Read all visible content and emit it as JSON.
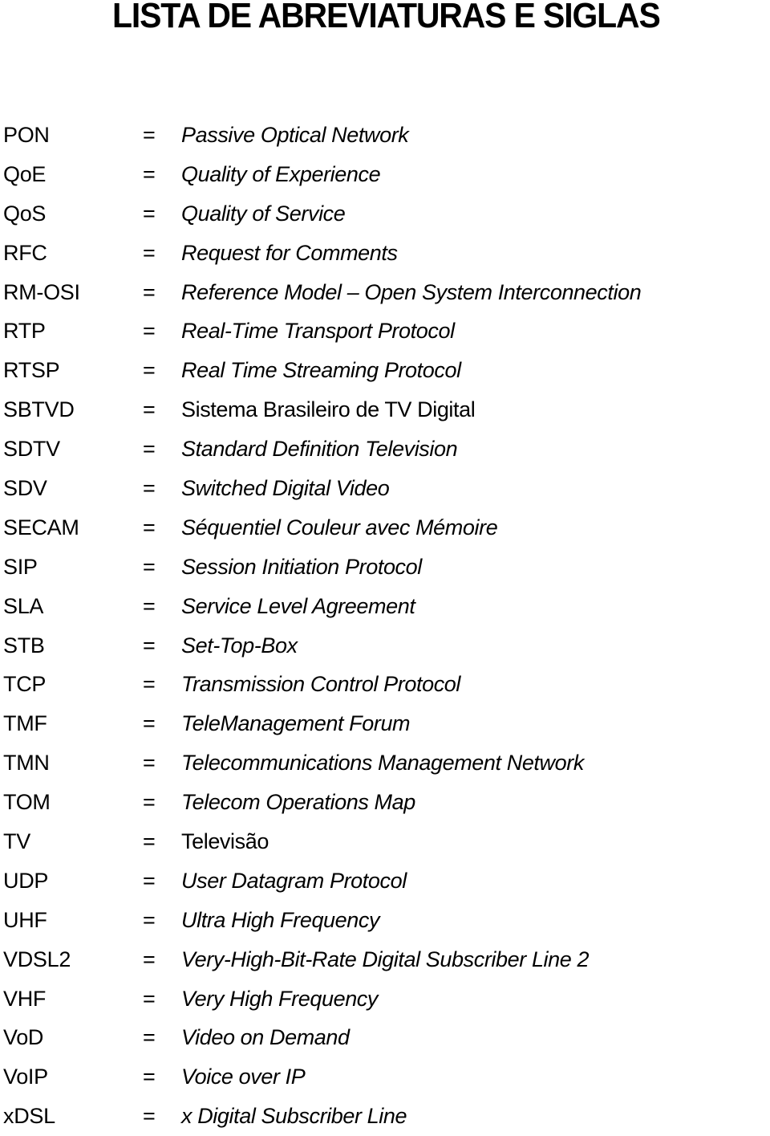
{
  "page": {
    "title": "LISTA DE ABREVIATURAS E SIGLAS",
    "separator": "=",
    "entries": [
      {
        "abbr": "PON",
        "definition": "Passive Optical Network",
        "italic": true
      },
      {
        "abbr": "QoE",
        "definition": "Quality of Experience",
        "italic": true
      },
      {
        "abbr": "QoS",
        "definition": "Quality of Service",
        "italic": true
      },
      {
        "abbr": "RFC",
        "definition": "Request for Comments",
        "italic": true
      },
      {
        "abbr": "RM-OSI",
        "definition": "Reference Model – Open System Interconnection",
        "italic": true
      },
      {
        "abbr": "RTP",
        "definition": "Real-Time Transport Protocol",
        "italic": true
      },
      {
        "abbr": "RTSP",
        "definition": "Real Time Streaming Protocol",
        "italic": true
      },
      {
        "abbr": "SBTVD",
        "definition": "Sistema Brasileiro de TV Digital",
        "italic": false
      },
      {
        "abbr": "SDTV",
        "definition": "Standard Definition Television",
        "italic": true
      },
      {
        "abbr": "SDV",
        "definition": "Switched Digital Video",
        "italic": true
      },
      {
        "abbr": "SECAM",
        "definition": "Séquentiel Couleur avec Mémoire",
        "italic": true
      },
      {
        "abbr": "SIP",
        "definition": "Session Initiation Protocol",
        "italic": true
      },
      {
        "abbr": "SLA",
        "definition": "Service Level Agreement",
        "italic": true
      },
      {
        "abbr": "STB",
        "definition": "Set-Top-Box",
        "italic": true
      },
      {
        "abbr": "TCP",
        "definition": "Transmission Control Protocol",
        "italic": true
      },
      {
        "abbr": "TMF",
        "definition": "TeleManagement Forum",
        "italic": true
      },
      {
        "abbr": "TMN",
        "definition": "Telecommunications Management Network",
        "italic": true
      },
      {
        "abbr": "TOM",
        "definition": "Telecom Operations Map",
        "italic": true
      },
      {
        "abbr": "TV",
        "definition": "Televisão",
        "italic": false
      },
      {
        "abbr": "UDP",
        "definition": "User Datagram Protocol",
        "italic": true
      },
      {
        "abbr": "UHF",
        "definition": "Ultra High Frequency",
        "italic": true
      },
      {
        "abbr": "VDSL2",
        "definition": "Very-High-Bit-Rate Digital Subscriber Line 2",
        "italic": true
      },
      {
        "abbr": "VHF",
        "definition": "Very High Frequency",
        "italic": true
      },
      {
        "abbr": "VoD",
        "definition": "Video on Demand",
        "italic": true
      },
      {
        "abbr": "VoIP",
        "definition": "Voice over IP",
        "italic": true
      },
      {
        "abbr": "xDSL",
        "definition": "x Digital Subscriber Line",
        "italic": true
      }
    ]
  }
}
